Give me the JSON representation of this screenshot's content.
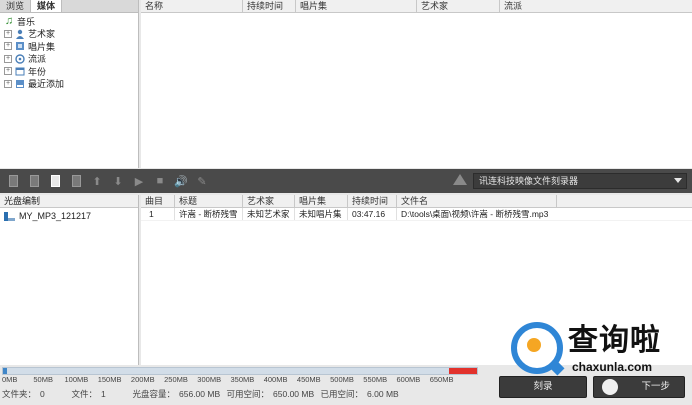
{
  "sidebar": {
    "tabs": [
      {
        "label": "浏览",
        "active": false
      },
      {
        "label": "媒体",
        "active": true
      }
    ],
    "tree": {
      "root": "音乐",
      "items": [
        "艺术家",
        "唱片集",
        "流派",
        "年份",
        "最近添加"
      ]
    }
  },
  "library": {
    "columns": [
      "名称",
      "持续时间",
      "唱片集",
      "艺术家",
      "流派"
    ]
  },
  "toolbar": {
    "burner": "讯连科技映像文件刻录器"
  },
  "disc": {
    "header": "光盘编制",
    "name": "MY_MP3_121217"
  },
  "tracks": {
    "columns": [
      "曲目",
      "标题",
      "艺术家",
      "唱片集",
      "持续时间",
      "文件名"
    ],
    "rows": [
      {
        "num": "1",
        "title": "许嵩 - 断桥残雪",
        "artist": "未知艺术家",
        "album": "未知唱片集",
        "duration": "03:47.16",
        "file": "D:\\tools\\桌面\\视频\\许嵩 - 断桥残雪.mp3"
      }
    ]
  },
  "capacity": {
    "ticks": [
      "0MB",
      "50MB",
      "100MB",
      "150MB",
      "200MB",
      "250MB",
      "300MB",
      "350MB",
      "400MB",
      "450MB",
      "500MB",
      "550MB",
      "600MB",
      "650MB"
    ],
    "used_fraction": 0.009
  },
  "status": {
    "folders_label": "文件夹：",
    "folders_value": "0",
    "files_label": "文件：",
    "files_value": "1",
    "capacity_label": "光盘容量：",
    "capacity_value": "656.00 MB",
    "free_label": "可用空间：",
    "free_value": "650.00 MB",
    "used_label": "已用空间：",
    "used_value": "6.00 MB"
  },
  "buttons": {
    "burn": "刻录",
    "next": "下一步"
  },
  "watermark": {
    "title": "查询啦",
    "url": "chaxunla.com"
  },
  "colors": {
    "toolbar_bg": "#4a4a4a",
    "capacity_fill": "#3f86c8",
    "capacity_limit": "#e2322c",
    "watermark_blue": "#2f86d6",
    "watermark_orange": "#f5a623"
  }
}
